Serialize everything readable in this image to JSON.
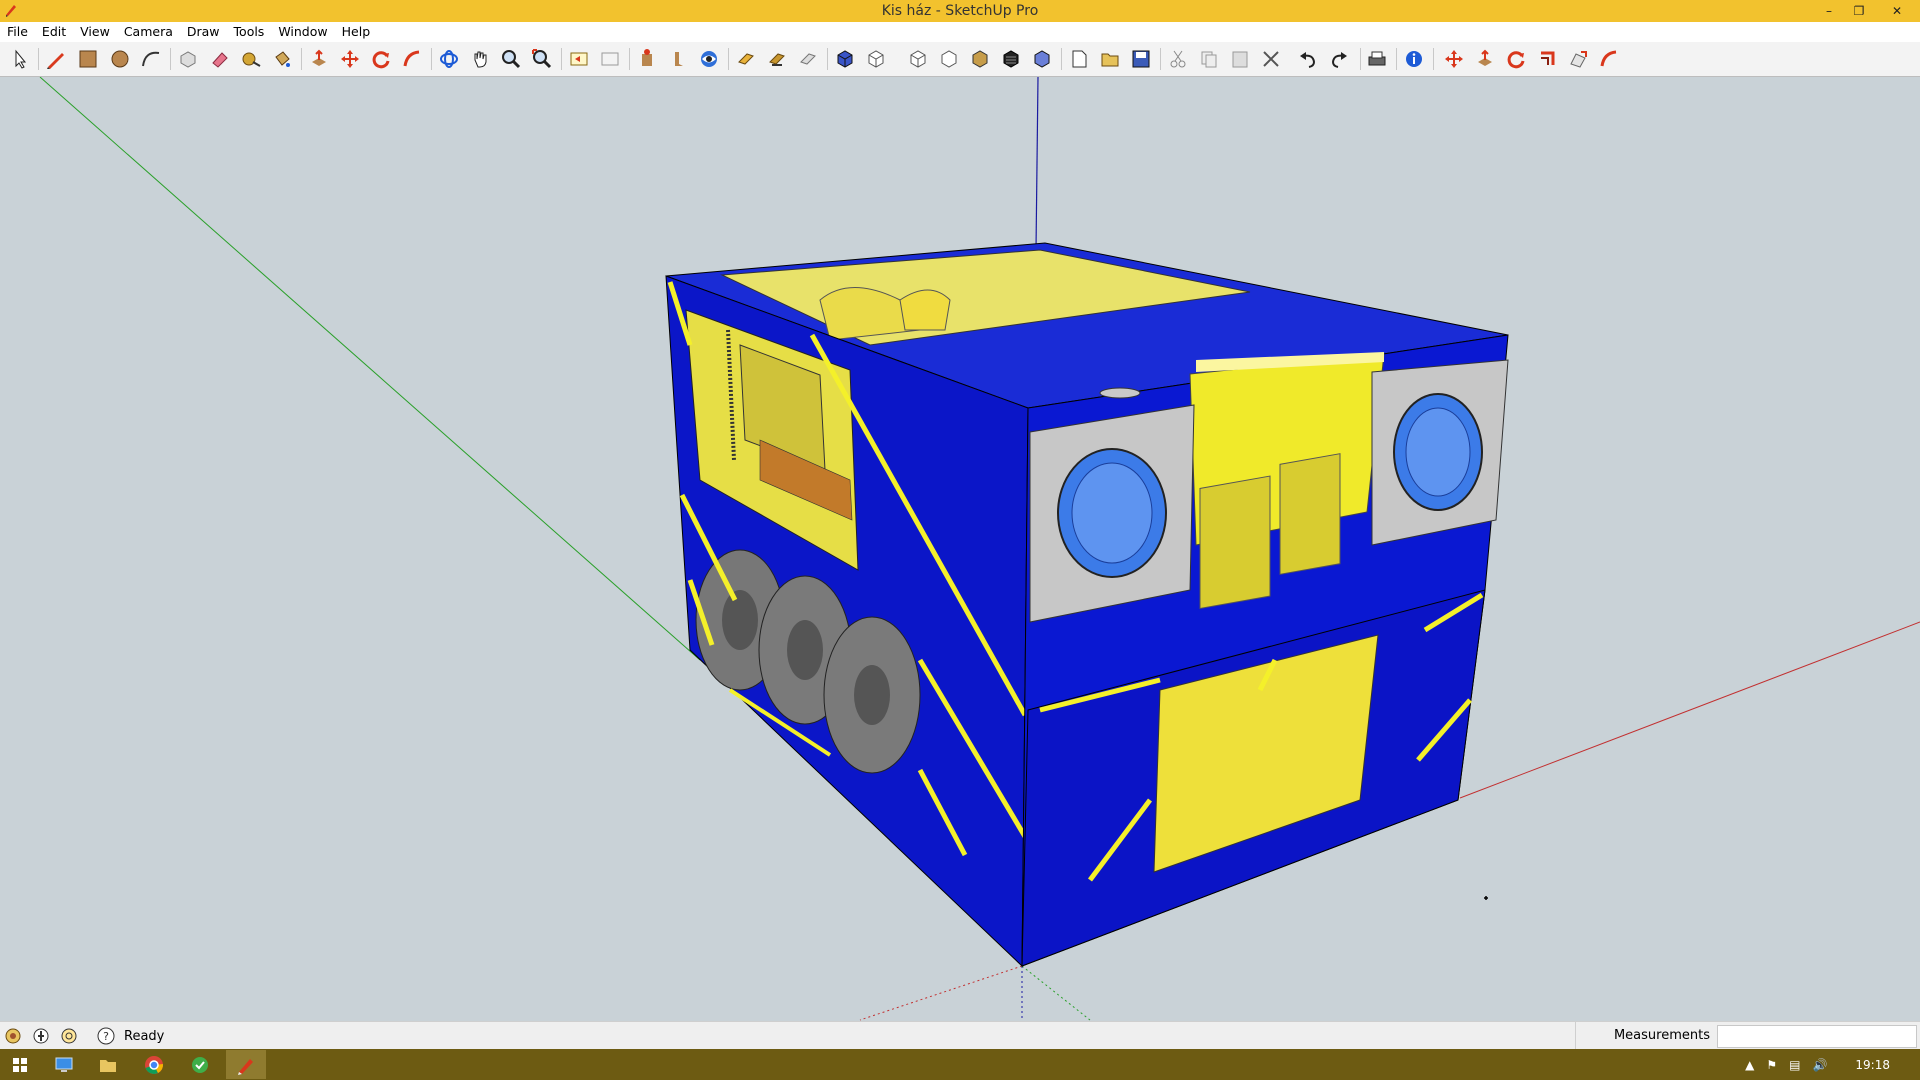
{
  "window": {
    "title": "Kis ház - SketchUp Pro"
  },
  "menu": [
    "File",
    "Edit",
    "View",
    "Camera",
    "Draw",
    "Tools",
    "Window",
    "Help"
  ],
  "toolbar": {
    "tools": [
      "select-tool-icon",
      "pencil-line-icon",
      "rectangle-icon",
      "circle-icon",
      "arc-icon",
      "make-component-icon",
      "eraser-icon",
      "tape-measure-icon",
      "paint-bucket-icon",
      "push-pull-icon",
      "move-icon",
      "rotate-icon",
      "follow-me-icon",
      "orbit-icon",
      "pan-icon",
      "zoom-icon",
      "zoom-extents-icon",
      "previous-view-icon",
      "next-view-icon",
      "position-camera-icon",
      "walk-icon",
      "look-around-icon",
      "section-plane-icon",
      "display-section-icon",
      "section-cut-icon",
      "iso-view-icon",
      "top-view-icon",
      "front-view-icon",
      "right-view-icon",
      "back-view-icon",
      "left-view-icon",
      "bottom-view-icon",
      "new-icon",
      "open-icon",
      "save-icon",
      "cut-icon",
      "copy-icon",
      "paste-icon",
      "erase-icon",
      "undo-icon",
      "redo-icon",
      "print-icon",
      "model-info-icon",
      "scale-icon",
      "push-pull-2-icon",
      "rotate-2-icon",
      "offset-icon",
      "outer-shell-icon",
      "follow-me-2-icon"
    ]
  },
  "status": {
    "text": "Ready",
    "measurements_label": "Measurements",
    "measurements_value": ""
  },
  "taskbar": {
    "time": "19:18",
    "apps": [
      "windows-start-icon",
      "desktop-icon",
      "file-explorer-icon",
      "chrome-icon",
      "vpn-app-icon",
      "sketchup-icon"
    ],
    "active_app": "sketchup-icon"
  },
  "colors": {
    "titlebar": "#f2c22e",
    "viewport_bg": "#c9d2d7",
    "model_blue": "#0b16c8",
    "model_yellow": "#f4f02a",
    "taskbar": "#6d5b12"
  }
}
